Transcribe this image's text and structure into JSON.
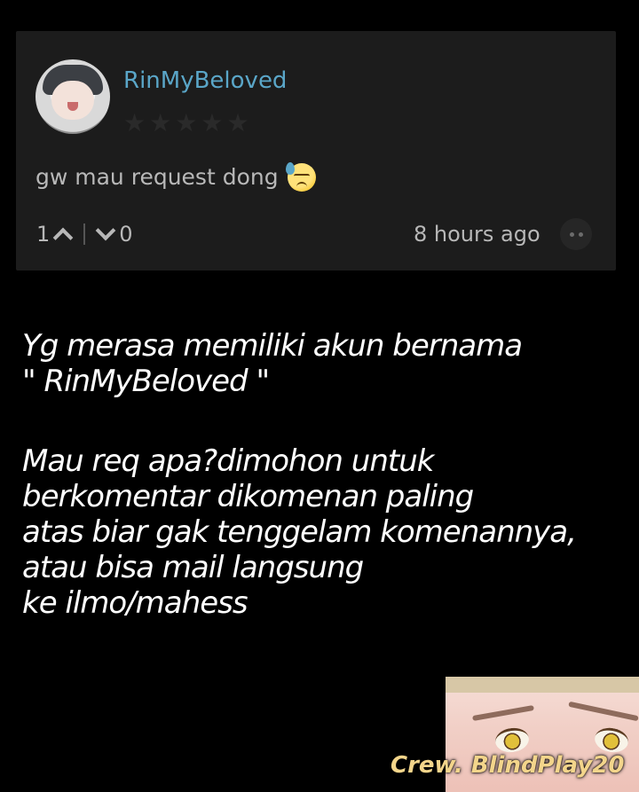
{
  "comment": {
    "username": "RinMyBeloved",
    "rating_stars": 5,
    "text": "gw mau request dong",
    "emoji_name": "downcast-face-with-sweat-emoji",
    "upvotes": "1",
    "downvotes": "0",
    "timestamp": "8 hours ago"
  },
  "notice": {
    "line1": "Yg merasa memiliki akun bernama",
    "line2": "\" RinMyBeloved \"",
    "line3": "Mau req apa?dimohon untuk",
    "line4": "berkomentar dikomenan paling",
    "line5": "atas biar gak tenggelam komenannya,",
    "line6": "atau bisa mail langsung",
    "line7": "ke ilmo/mahess"
  },
  "watermark": "Crew. BlindPlay20",
  "colors": {
    "username": "#5aa6c8",
    "card_bg": "#1c1c1c",
    "page_bg": "#000000",
    "watermark": "#f3d58b"
  }
}
